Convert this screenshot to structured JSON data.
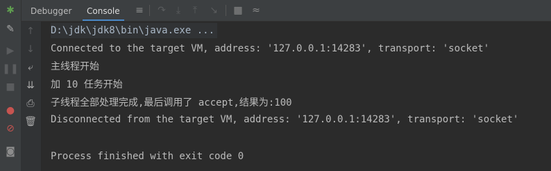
{
  "tabs": {
    "debugger": "Debugger",
    "console": "Console"
  },
  "icons": {
    "debug": "bug-icon",
    "settings": "wrench-icon",
    "resume": "resume-icon",
    "pause": "pause-icon",
    "stop": "stop-icon",
    "breakpoints": "breakpoints-icon",
    "mute": "mute-breakpoints-icon",
    "camera": "camera-icon",
    "up": "arrow-up-icon",
    "down": "arrow-down-icon",
    "wrap": "soft-wrap-icon",
    "scroll": "scroll-to-end-icon",
    "print": "print-icon",
    "trash": "clear-all-icon"
  },
  "console": {
    "lines": [
      "D:\\jdk\\jdk8\\bin\\java.exe ...",
      "Connected to the target VM, address: '127.0.0.1:14283', transport: 'socket'",
      "主线程开始",
      "加 10 任务开始",
      "子线程全部处理完成,最后调用了 accept,结果为:100",
      "Disconnected from the target VM, address: '127.0.0.1:14283', transport: 'socket'",
      "",
      "Process finished with exit code 0"
    ]
  }
}
